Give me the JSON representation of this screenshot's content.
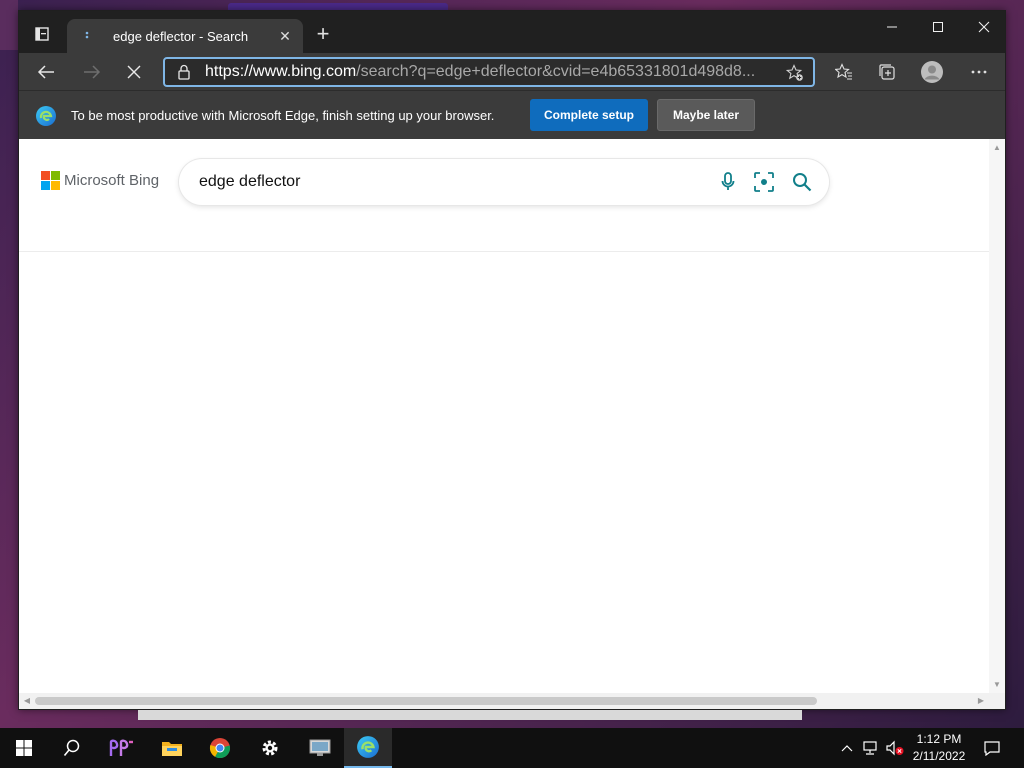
{
  "browser": {
    "tab": {
      "title": "edge deflector - Search"
    },
    "address": {
      "url_host": "https://www.bing.com",
      "url_rest": "/search?q=edge+deflector&cvid=e4b65331801d498d8..."
    }
  },
  "infobar": {
    "message": "To be most productive with Microsoft Edge, finish setting up your browser.",
    "complete_label": "Complete setup",
    "later_label": "Maybe later"
  },
  "bing": {
    "logo_text": "Microsoft Bing",
    "query": "edge deflector"
  },
  "taskbar": {
    "time": "1:12 PM",
    "date": "2/11/2022"
  },
  "colors": {
    "accent": "#0f6cbd",
    "bing_teal": "#117f8a",
    "address_focus": "#7fb6e6"
  }
}
